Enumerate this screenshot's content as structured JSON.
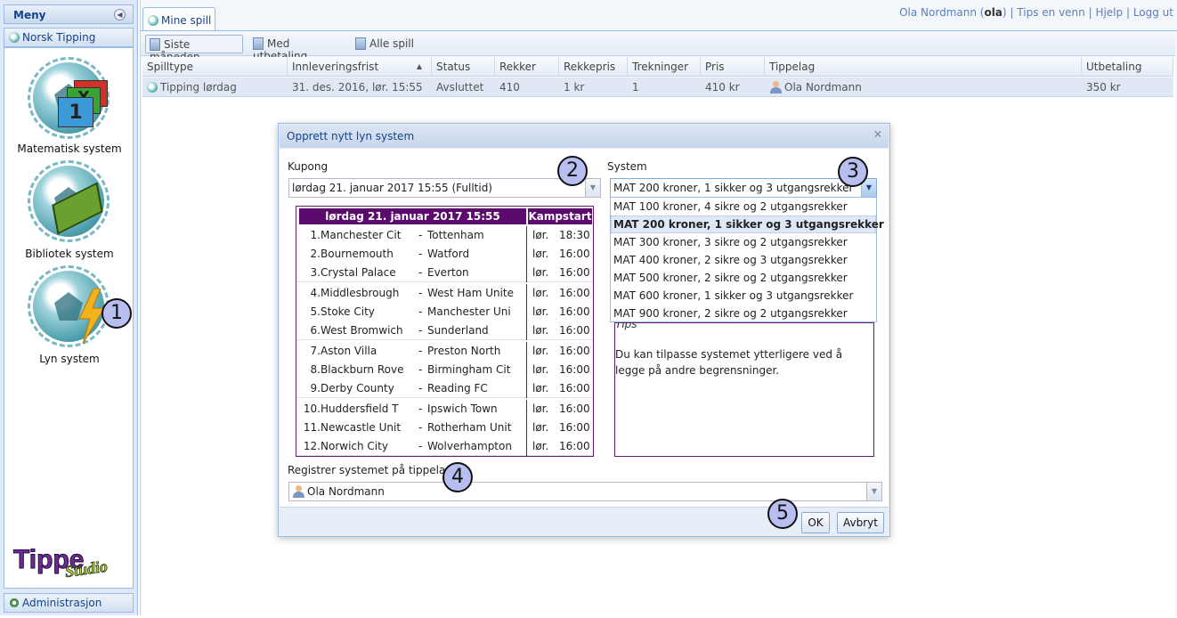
{
  "menu": {
    "title": "Meny",
    "collapse_icon": "collapse-left-icon",
    "section_label": "Norsk Tipping",
    "items": [
      {
        "label": "Matematisk system"
      },
      {
        "label": "Bibliotek system"
      },
      {
        "label": "Lyn system"
      }
    ],
    "logo_text": "TippeStudio",
    "admin_label": "Administrasjon"
  },
  "header": {
    "user_name": "Ola Nordmann",
    "user_id": "ola",
    "links": [
      "Tips en venn",
      "Hjelp",
      "Logg ut"
    ]
  },
  "tabs": [
    {
      "label": "Mine spill"
    }
  ],
  "toolbar": {
    "buttons": [
      {
        "label": "Siste måneden"
      },
      {
        "label": "Med utbetaling"
      },
      {
        "label": "Alle spill"
      }
    ]
  },
  "grid": {
    "columns": [
      "Spilltype",
      "Innleveringsfrist",
      "Status",
      "Rekker",
      "Rekkepris",
      "Trekninger",
      "Pris",
      "Tippelag",
      "Utbetaling"
    ],
    "rows": [
      [
        "Tipping lørdag",
        "31. des. 2016, lør. 15:55",
        "Avsluttet",
        "410",
        "1 kr",
        "1",
        "410 kr",
        "Ola Nordmann",
        "350 kr"
      ]
    ]
  },
  "dialog": {
    "title": "Opprett nytt lyn system",
    "close_icon": "close-icon",
    "kupong_label": "Kupong",
    "kupong_value": "lørdag 21. januar 2017 15:55 (Fulltid)",
    "system_label": "System",
    "system_value": "MAT 200 kroner, 1 sikker og 3 utgangsrekker",
    "coupon_header": "lørdag 21. januar 2017 15:55",
    "coupon_header_right": "Kampstart",
    "matches": [
      {
        "n": "1.",
        "home": "Manchester Cit",
        "away": "Tottenham",
        "day": "lør.",
        "time": "18:30"
      },
      {
        "n": "2.",
        "home": "Bournemouth",
        "away": "Watford",
        "day": "lør.",
        "time": "16:00"
      },
      {
        "n": "3.",
        "home": "Crystal Palace",
        "away": "Everton",
        "day": "lør.",
        "time": "16:00"
      },
      {
        "n": "4.",
        "home": "Middlesbrough",
        "away": "West Ham Unite",
        "day": "lør.",
        "time": "16:00"
      },
      {
        "n": "5.",
        "home": "Stoke City",
        "away": "Manchester Uni",
        "day": "lør.",
        "time": "16:00"
      },
      {
        "n": "6.",
        "home": "West Bromwich",
        "away": "Sunderland",
        "day": "lør.",
        "time": "16:00"
      },
      {
        "n": "7.",
        "home": "Aston Villa",
        "away": "Preston North",
        "day": "lør.",
        "time": "16:00"
      },
      {
        "n": "8.",
        "home": "Blackburn Rove",
        "away": "Birmingham Cit",
        "day": "lør.",
        "time": "16:00"
      },
      {
        "n": "9.",
        "home": "Derby County",
        "away": "Reading FC",
        "day": "lør.",
        "time": "16:00"
      },
      {
        "n": "10.",
        "home": "Huddersfield T",
        "away": "Ipswich Town",
        "day": "lør.",
        "time": "16:00"
      },
      {
        "n": "11.",
        "home": "Newcastle Unit",
        "away": "Rotherham Unit",
        "day": "lør.",
        "time": "16:00"
      },
      {
        "n": "12.",
        "home": "Norwich City",
        "away": "Wolverhampton",
        "day": "lør.",
        "time": "16:00"
      }
    ],
    "dash": "-",
    "system_options": [
      "MAT 100 kroner, 4 sikre og 2 utgangsrekker",
      "MAT 200 kroner, 1 sikker og 3 utgangsrekker",
      "MAT 300 kroner, 3 sikre og 2 utgangsrekker",
      "MAT 400 kroner, 2 sikre og 3 utgangsrekker",
      "MAT 500 kroner, 2 sikre og 2 utgangsrekker",
      "MAT 600 kroner, 1 sikker og 3 utgangsrekker",
      "MAT 900 kroner, 2 sikre og 2 utgangsrekker"
    ],
    "selected_option_index": 1,
    "tips_title": "Tips",
    "tips_text": "Du kan tilpasse systemet ytterligere ved å legge på andre begrensninger.",
    "register_label": "Registrer systemet på tippelaget",
    "register_value": "Ola Nordmann",
    "ok_label": "OK",
    "cancel_label": "Avbryt"
  },
  "callouts": [
    "1",
    "2",
    "3",
    "4",
    "5"
  ]
}
